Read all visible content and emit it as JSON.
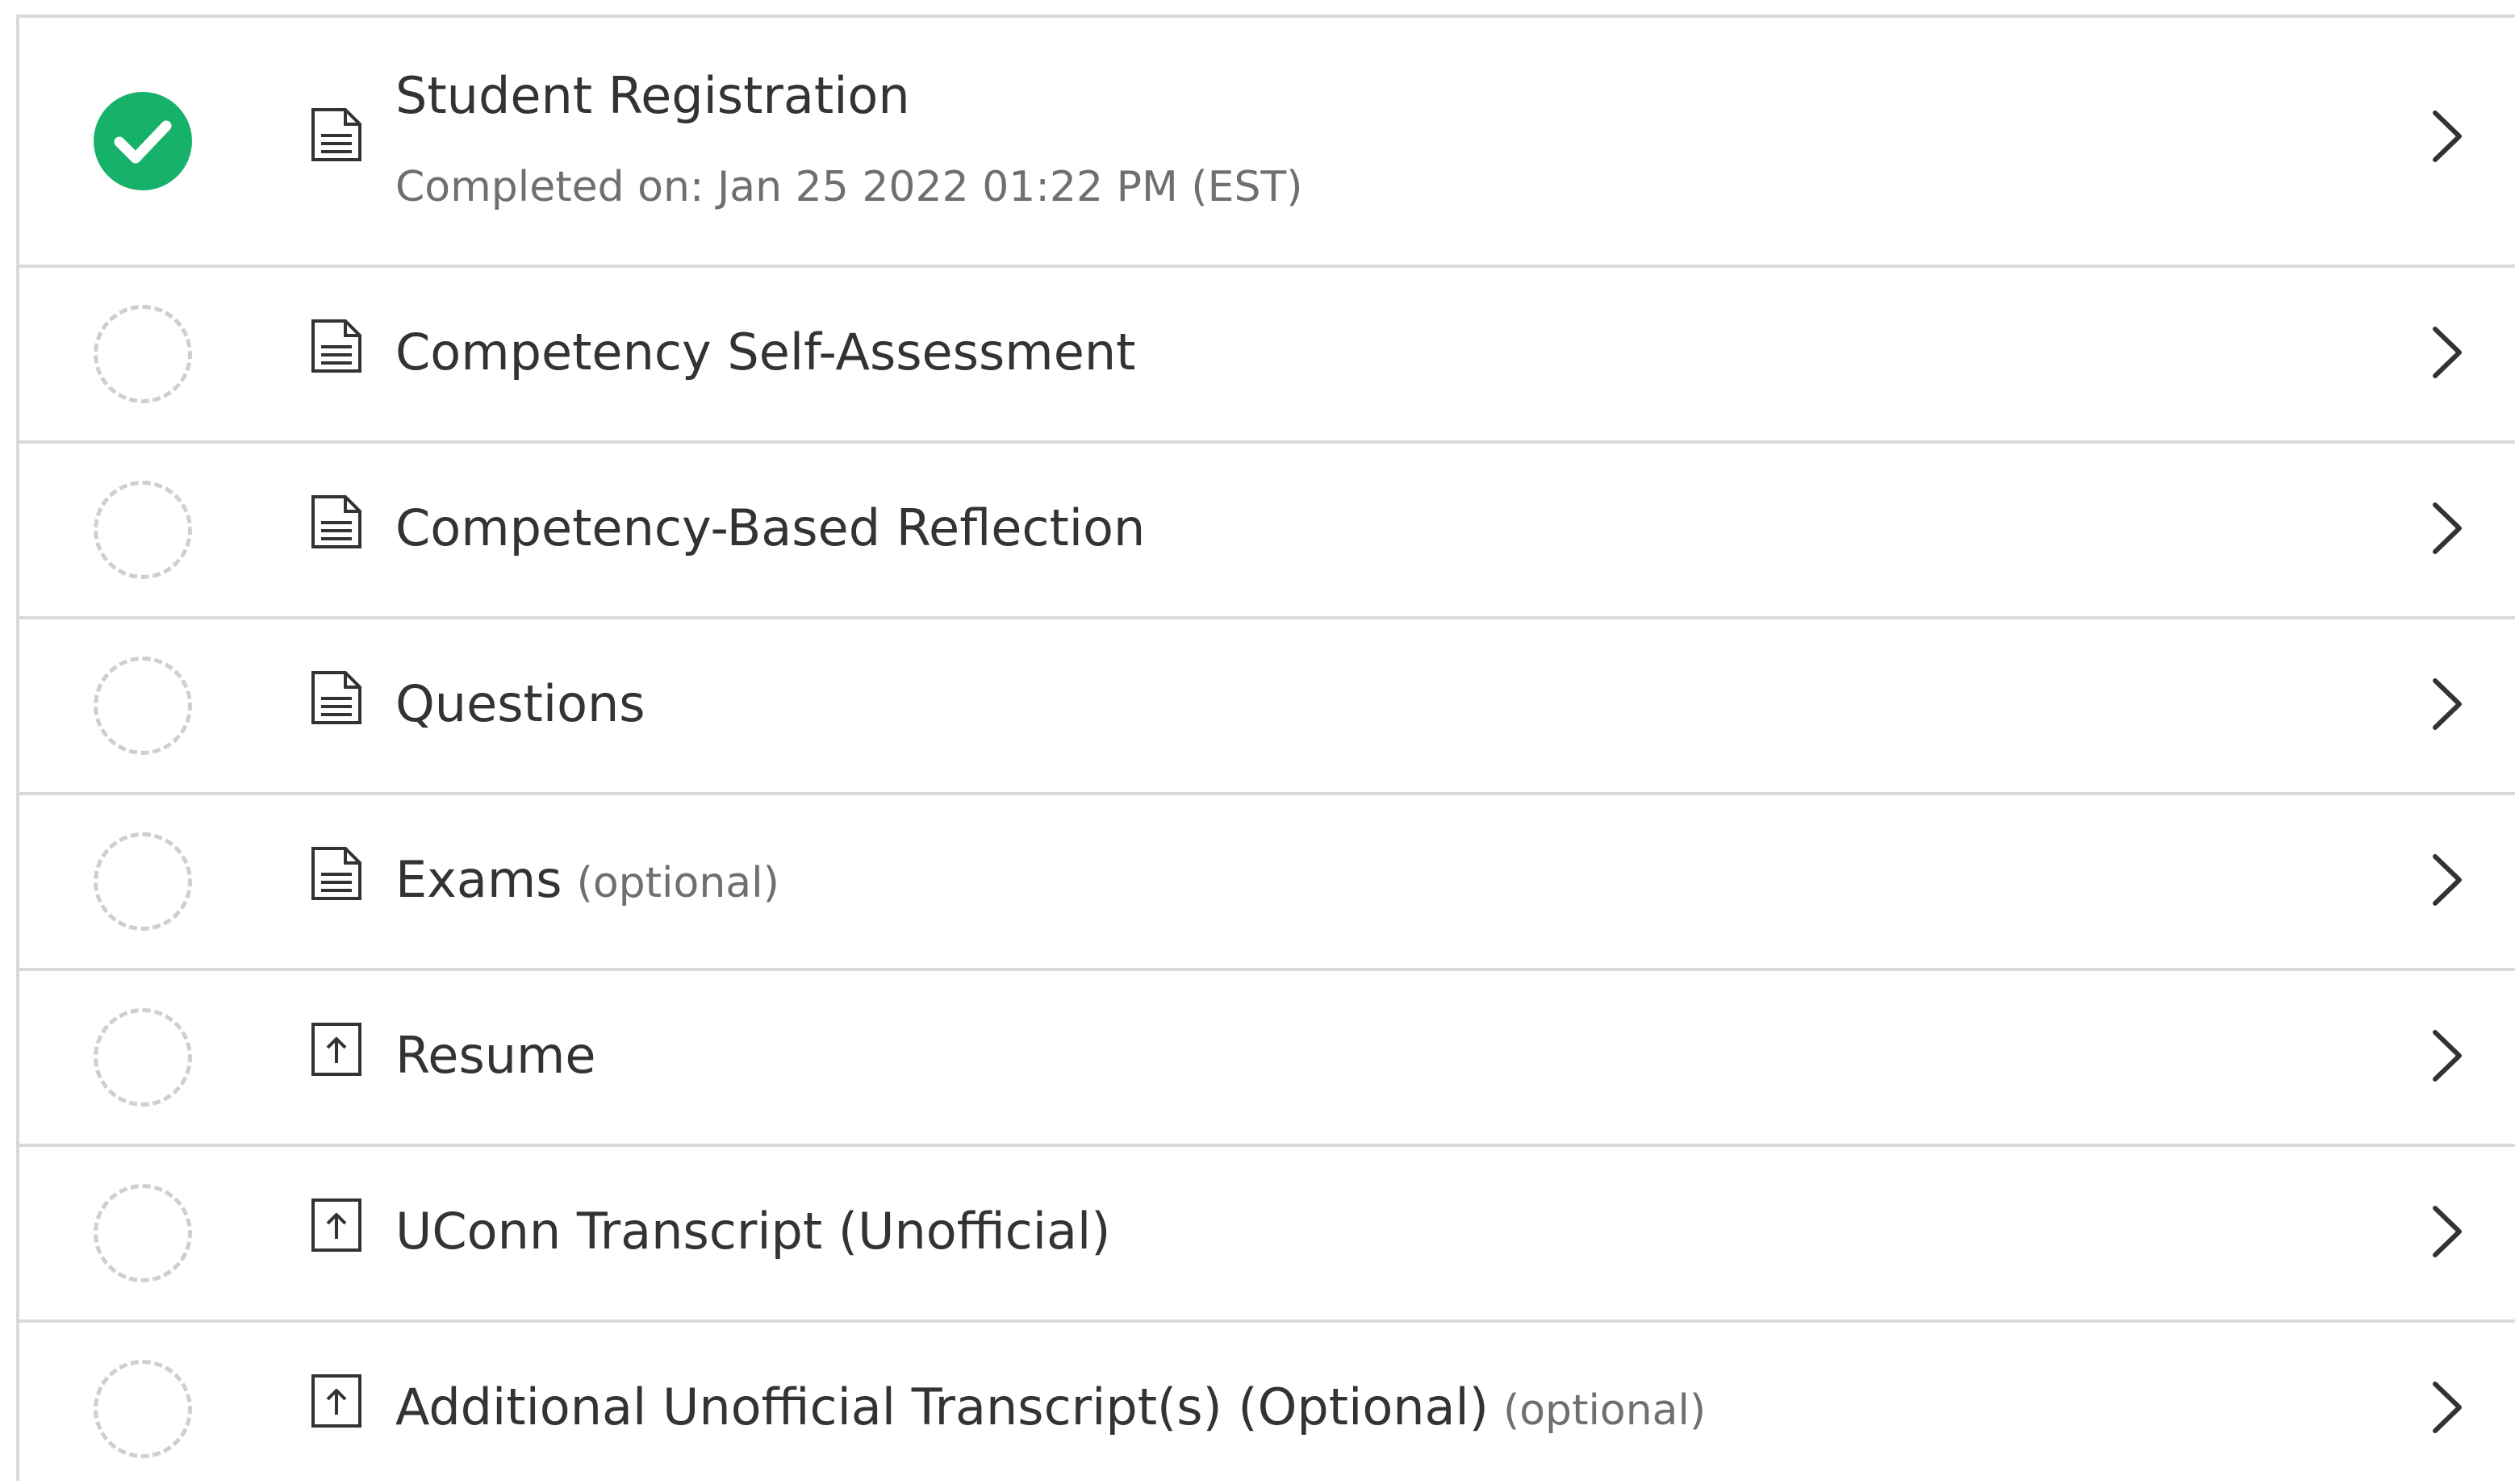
{
  "colors": {
    "complete": "#17b26a",
    "divider": "#d9d9d9",
    "text": "#333333",
    "muted": "#6f6f6f",
    "pending_ring": "#cfcfcf"
  },
  "items": [
    {
      "title": "Student Registration",
      "subtitle": "Completed on: Jan 25 2022 01:22 PM (EST)",
      "optional_tag": "",
      "status": "complete",
      "status_icon": "check-circle-icon",
      "type_icon": "document-icon"
    },
    {
      "title": "Competency Self-Assessment",
      "subtitle": "",
      "optional_tag": "",
      "status": "pending",
      "status_icon": "dashed-circle-icon",
      "type_icon": "document-icon"
    },
    {
      "title": "Competency-Based Reflection",
      "subtitle": "",
      "optional_tag": "",
      "status": "pending",
      "status_icon": "dashed-circle-icon",
      "type_icon": "document-icon"
    },
    {
      "title": "Questions",
      "subtitle": "",
      "optional_tag": "",
      "status": "pending",
      "status_icon": "dashed-circle-icon",
      "type_icon": "document-icon"
    },
    {
      "title": "Exams",
      "subtitle": "",
      "optional_tag": "(optional)",
      "status": "pending",
      "status_icon": "dashed-circle-icon",
      "type_icon": "document-icon"
    },
    {
      "title": "Resume",
      "subtitle": "",
      "optional_tag": "",
      "status": "pending",
      "status_icon": "dashed-circle-icon",
      "type_icon": "upload-icon"
    },
    {
      "title": "UConn Transcript (Unofficial)",
      "subtitle": "",
      "optional_tag": "",
      "status": "pending",
      "status_icon": "dashed-circle-icon",
      "type_icon": "upload-icon"
    },
    {
      "title": "Additional Unofficial Transcript(s) (Optional)",
      "subtitle": "",
      "optional_tag": "(optional)",
      "status": "pending",
      "status_icon": "dashed-circle-icon",
      "type_icon": "upload-icon"
    }
  ]
}
